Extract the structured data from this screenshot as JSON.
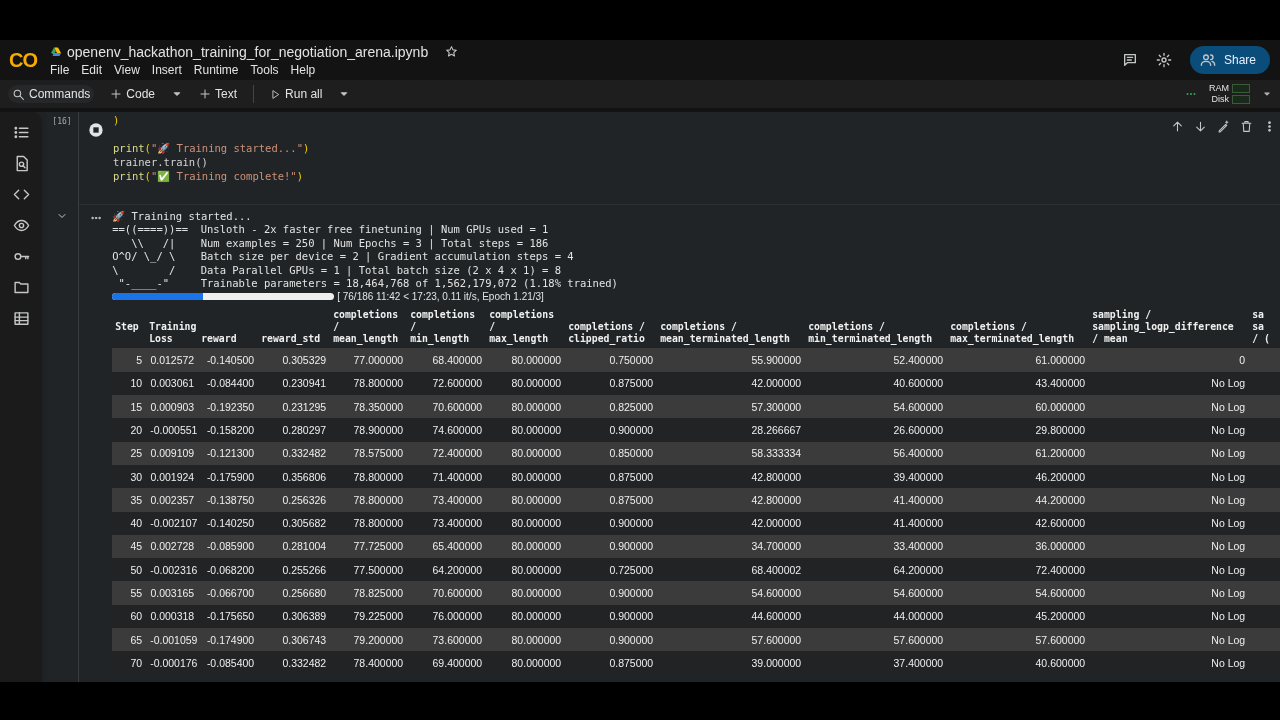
{
  "app": {
    "logo": "CO",
    "title": "openenv_hackathon_training_for_negotiation_arena.ipynb",
    "starred": false,
    "menu": [
      "File",
      "Edit",
      "View",
      "Insert",
      "Runtime",
      "Tools",
      "Help"
    ],
    "share": "Share"
  },
  "toolbar": {
    "commands": "Commands",
    "add_code": "Code",
    "add_text": "Text",
    "run_all": "Run all",
    "resources": [
      "RAM",
      "Disk"
    ]
  },
  "cell": {
    "execution_count": "[16]",
    "running": true,
    "code": [
      [
        {
          "kind": "paren",
          "text": ")"
        }
      ],
      [
        {
          "kind": "fn",
          "text": "print"
        },
        {
          "kind": "paren",
          "text": "("
        },
        {
          "kind": "str",
          "text": "\"🚀 Training started...\""
        },
        {
          "kind": "paren",
          "text": ")"
        }
      ],
      [
        {
          "kind": "plain",
          "text": "trainer.train()"
        }
      ],
      [
        {
          "kind": "fn",
          "text": "print"
        },
        {
          "kind": "paren",
          "text": "("
        },
        {
          "kind": "str",
          "text": "\"✅ Training complete!\""
        },
        {
          "kind": "paren",
          "text": ")"
        }
      ]
    ],
    "output": {
      "expanded": true,
      "lines": [
        "🚀 Training started...",
        "==((====))==  Unsloth - 2x faster free finetuning | Num GPUs used = 1",
        "   \\\\   /|    Num examples = 250 | Num Epochs = 3 | Total steps = 186",
        "O^O/ \\_/ \\    Batch size per device = 2 | Gradient accumulation steps = 4",
        "\\        /    Data Parallel GPUs = 1 | Total batch size (2 x 4 x 1) = 8",
        " \"-____-\"     Trainable parameters = 18,464,768 of 1,562,179,072 (1.18% trained)"
      ],
      "progress": {
        "level": 0.41,
        "text": "[ 76/186 11:42 < 17:23, 0.11 it/s, Epoch 1.21/3]"
      },
      "table": {
        "columns": [
          "Step",
          "Training\nLoss",
          "reward",
          "reward_std",
          "completions\n/\nmean_length",
          "completions\n/\nmin_length",
          "completions\n/\nmax_length",
          "completions /\nclipped_ratio",
          "completions /\nmean_terminated_length",
          "completions /\nmin_terminated_length",
          "completions /\nmax_terminated_length",
          "sampling /\nsampling_logp_difference\n/ mean",
          "sa\nsa\n/ ("
        ],
        "rows": [
          [
            "5",
            "0.012572",
            "-0.140500",
            "0.305329",
            "77.000000",
            "68.400000",
            "80.000000",
            "0.750000",
            "55.900000",
            "52.400000",
            "61.000000",
            "0"
          ],
          [
            "10",
            "0.003061",
            "-0.084400",
            "0.230941",
            "78.800000",
            "72.600000",
            "80.000000",
            "0.875000",
            "42.000000",
            "40.600000",
            "43.400000",
            "No Log"
          ],
          [
            "15",
            "0.000903",
            "-0.192350",
            "0.231295",
            "78.350000",
            "70.600000",
            "80.000000",
            "0.825000",
            "57.300000",
            "54.600000",
            "60.000000",
            "No Log"
          ],
          [
            "20",
            "-0.000551",
            "-0.158200",
            "0.280297",
            "78.900000",
            "74.600000",
            "80.000000",
            "0.900000",
            "28.266667",
            "26.600000",
            "29.800000",
            "No Log"
          ],
          [
            "25",
            "0.009109",
            "-0.121300",
            "0.332482",
            "78.575000",
            "72.400000",
            "80.000000",
            "0.850000",
            "58.333334",
            "56.400000",
            "61.200000",
            "No Log"
          ],
          [
            "30",
            "0.001924",
            "-0.175900",
            "0.356806",
            "78.800000",
            "71.400000",
            "80.000000",
            "0.875000",
            "42.800000",
            "39.400000",
            "46.200000",
            "No Log"
          ],
          [
            "35",
            "0.002357",
            "-0.138750",
            "0.256326",
            "78.800000",
            "73.400000",
            "80.000000",
            "0.875000",
            "42.800000",
            "41.400000",
            "44.200000",
            "No Log"
          ],
          [
            "40",
            "-0.002107",
            "-0.140250",
            "0.305682",
            "78.800000",
            "73.400000",
            "80.000000",
            "0.900000",
            "42.000000",
            "41.400000",
            "42.600000",
            "No Log"
          ],
          [
            "45",
            "0.002728",
            "-0.085900",
            "0.281004",
            "77.725000",
            "65.400000",
            "80.000000",
            "0.900000",
            "34.700000",
            "33.400000",
            "36.000000",
            "No Log"
          ],
          [
            "50",
            "-0.002316",
            "-0.068200",
            "0.255266",
            "77.500000",
            "64.200000",
            "80.000000",
            "0.725000",
            "68.400002",
            "64.200000",
            "72.400000",
            "No Log"
          ],
          [
            "55",
            "0.003165",
            "-0.066700",
            "0.256680",
            "78.825000",
            "70.600000",
            "80.000000",
            "0.900000",
            "54.600000",
            "54.600000",
            "54.600000",
            "No Log"
          ],
          [
            "60",
            "0.000318",
            "-0.175650",
            "0.306389",
            "79.225000",
            "76.000000",
            "80.000000",
            "0.900000",
            "44.600000",
            "44.000000",
            "45.200000",
            "No Log"
          ],
          [
            "65",
            "-0.001059",
            "-0.174900",
            "0.306743",
            "79.200000",
            "73.600000",
            "80.000000",
            "0.900000",
            "57.600000",
            "57.600000",
            "57.600000",
            "No Log"
          ],
          [
            "70",
            "-0.000176",
            "-0.085400",
            "0.332482",
            "78.400000",
            "69.400000",
            "80.000000",
            "0.875000",
            "39.000000",
            "37.400000",
            "40.600000",
            "No Log"
          ]
        ]
      }
    }
  }
}
